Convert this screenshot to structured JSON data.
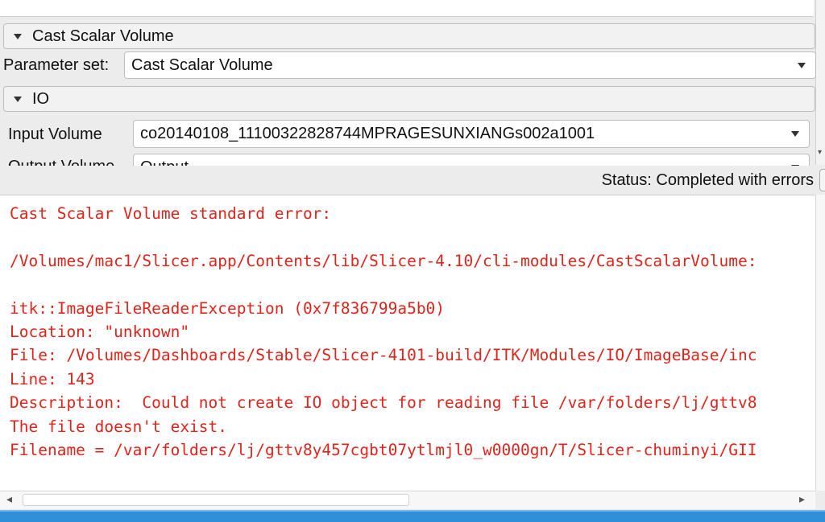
{
  "sections": {
    "module": {
      "label": "Cast Scalar Volume"
    },
    "io": {
      "label": "IO"
    }
  },
  "parameter_set": {
    "label": "Parameter set:",
    "value": "Cast Scalar Volume"
  },
  "input_volume": {
    "label": "Input Volume",
    "value": "co20140108_11100322828744MPRAGESUNXIANGs002a1001"
  },
  "output_volume": {
    "label": "Output Volume",
    "value": "Output"
  },
  "status": {
    "text": "Status: Completed with errors"
  },
  "console": {
    "lines": [
      "Cast Scalar Volume standard error:",
      "",
      "/Volumes/mac1/Slicer.app/Contents/lib/Slicer-4.10/cli-modules/CastScalarVolume:",
      "",
      "itk::ImageFileReaderException (0x7f836799a5b0)",
      "Location: \"unknown\"",
      "File: /Volumes/Dashboards/Stable/Slicer-4101-build/ITK/Modules/IO/ImageBase/inc",
      "Line: 143",
      "Description:  Could not create IO object for reading file /var/folders/lj/gttv8",
      "The file doesn't exist.",
      "Filename = /var/folders/lj/gttv8y457cgbt07ytlmjl0_w0000gn/T/Slicer-chuminyi/GII"
    ]
  },
  "colors": {
    "error_text": "#e0241b",
    "accent": "#2f8fd8"
  }
}
